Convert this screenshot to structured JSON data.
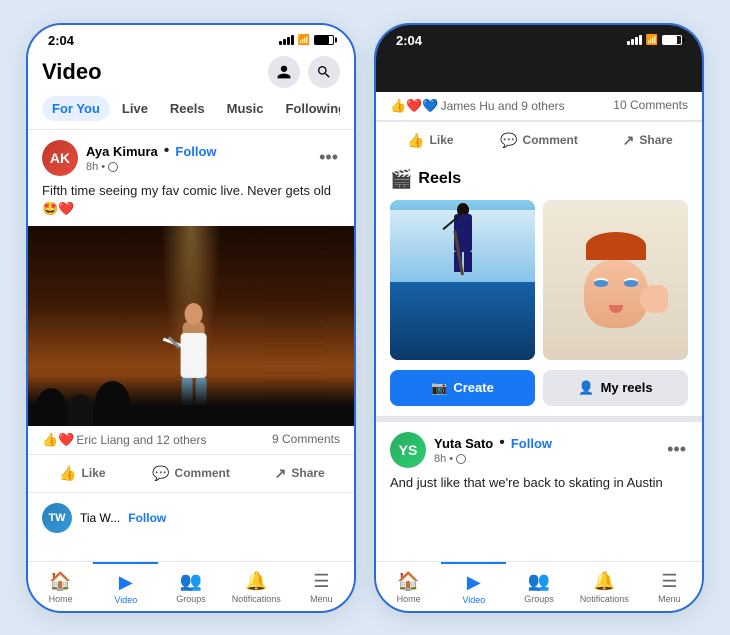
{
  "leftPhone": {
    "statusBar": {
      "time": "2:04"
    },
    "header": {
      "title": "Video"
    },
    "tabs": [
      {
        "label": "For You",
        "active": true
      },
      {
        "label": "Live",
        "active": false
      },
      {
        "label": "Reels",
        "active": false
      },
      {
        "label": "Music",
        "active": false
      },
      {
        "label": "Following",
        "active": false
      }
    ],
    "post": {
      "author": "Aya Kimura",
      "followLabel": "Follow",
      "time": "8h",
      "text": "Fifth time seeing my fav comic live. Never gets old 🤩❤️",
      "reactions": "👍❤️",
      "reactors": "Eric Liang and 12 others",
      "comments": "9 Comments"
    },
    "postActions": {
      "like": "Like",
      "comment": "Comment",
      "share": "Share"
    },
    "nav": [
      {
        "label": "Home",
        "icon": "🏠",
        "active": false
      },
      {
        "label": "Video",
        "icon": "▶",
        "active": true
      },
      {
        "label": "Groups",
        "icon": "👥",
        "active": false
      },
      {
        "label": "Notifications",
        "icon": "🔔",
        "active": false
      },
      {
        "label": "Menu",
        "icon": "☰",
        "active": false
      }
    ]
  },
  "rightPhone": {
    "statusBar": {
      "time": "2:04"
    },
    "reactionsRow": {
      "emojis": "👍❤️💙",
      "reactors": "James Hu and 9 others",
      "comments": "10 Comments"
    },
    "postActions": {
      "like": "Like",
      "comment": "Comment",
      "share": "Share"
    },
    "reelsSection": {
      "title": "Reels",
      "reels": [
        {
          "type": "paddleboard"
        },
        {
          "type": "makeup"
        }
      ],
      "createBtn": "Create",
      "myReelsBtn": "My reels"
    },
    "post2": {
      "author": "Yuta Sato",
      "followLabel": "Follow",
      "time": "8h",
      "text": "And just like that we're back to skating in Austin"
    },
    "nav": [
      {
        "label": "Home",
        "icon": "🏠",
        "active": false
      },
      {
        "label": "Video",
        "icon": "▶",
        "active": true
      },
      {
        "label": "Groups",
        "icon": "👥",
        "active": false
      },
      {
        "label": "Notifications",
        "icon": "🔔",
        "active": false
      },
      {
        "label": "Menu",
        "icon": "☰",
        "active": false
      }
    ]
  }
}
